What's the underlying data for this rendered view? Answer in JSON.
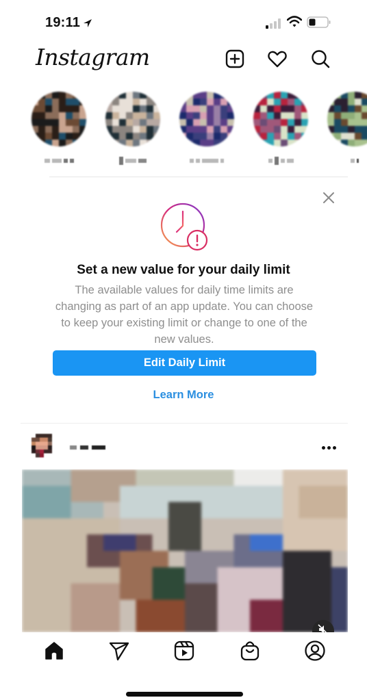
{
  "status_bar": {
    "time": "19:11",
    "location_icon": "location-arrow-icon",
    "signal_icon": "cellular-signal-icon",
    "signal_bars_active": 1,
    "signal_bars_total": 4,
    "wifi_icon": "wifi-icon",
    "battery_icon": "battery-icon",
    "battery_level": 0.35
  },
  "header": {
    "logo_text": "Instagram",
    "actions": [
      {
        "name": "new-post",
        "icon": "plus-square-icon"
      },
      {
        "name": "activity",
        "icon": "heart-icon"
      },
      {
        "name": "search",
        "icon": "search-icon"
      }
    ]
  },
  "stories": {
    "items": [
      {
        "name": "",
        "blurred": true,
        "colors": [
          "#2a1e17",
          "#6b4a34",
          "#c9a48f",
          "#1b1b1b",
          "#1f4e6a",
          "#8b6d5a"
        ]
      },
      {
        "name": "",
        "blurred": true,
        "colors": [
          "#1f2f37",
          "#b7a9a3",
          "#e8e0d8",
          "#8c8580",
          "#c9b39c",
          "#6e7780"
        ]
      },
      {
        "name": "",
        "blurred": true,
        "colors": [
          "#1b2a6b",
          "#5a3e86",
          "#d8a0b2",
          "#9a7fa6",
          "#c8c0ae",
          "#3a3f7c"
        ]
      },
      {
        "name": "",
        "blurred": true,
        "colors": [
          "#b8233e",
          "#3b1c3a",
          "#2aa3b3",
          "#d9e3c8",
          "#6b4d76",
          "#a0587a"
        ]
      },
      {
        "name": "",
        "blurred": true,
        "colors": [
          "#a9c28e",
          "#2b2030",
          "#6a4a30",
          "#1a4a62",
          "#dfe0d0",
          "#8fae79"
        ]
      }
    ]
  },
  "daily_limit_card": {
    "close_icon": "close-icon",
    "illustration_icon": "clock-alert-icon",
    "title": "Set a new value for your daily limit",
    "body": "The available values for daily time limits are changing as part of an app update. You can choose to keep your existing limit or change to one of the new values.",
    "primary_button": "Edit Daily Limit",
    "secondary_link": "Learn More",
    "colors": {
      "primary": "#1a95f3",
      "link": "#2b8fe0",
      "body_text": "#8e8e8e"
    }
  },
  "post": {
    "username": "",
    "username_blurred": true,
    "more_icon": "more-horizontal-icon",
    "media_blurred": true,
    "mute_icon": "speaker-muted-icon"
  },
  "tab_bar": {
    "items": [
      {
        "name": "home",
        "icon": "home-icon",
        "active": true
      },
      {
        "name": "direct",
        "icon": "paper-plane-icon",
        "active": false
      },
      {
        "name": "reels",
        "icon": "reels-icon",
        "active": false
      },
      {
        "name": "shop",
        "icon": "shopping-bag-icon",
        "active": false
      },
      {
        "name": "profile",
        "icon": "profile-icon",
        "active": false
      }
    ]
  }
}
